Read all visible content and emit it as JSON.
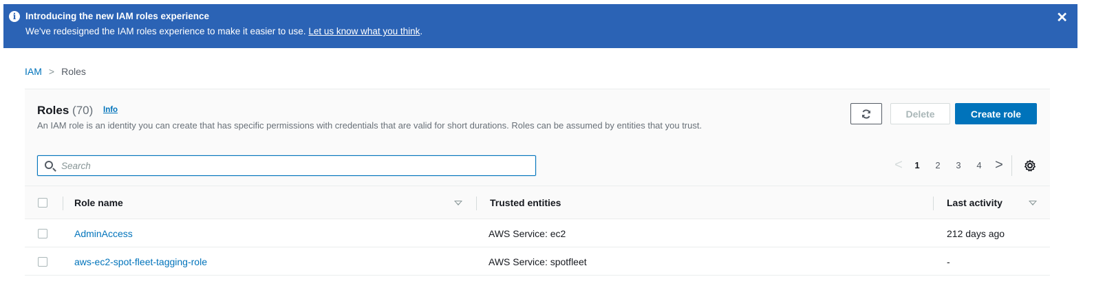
{
  "banner": {
    "title": "Introducing the new IAM roles experience",
    "message": "We've redesigned the IAM roles experience to make it easier to use.",
    "link_text": "Let us know what you think",
    "link_suffix": ".",
    "close_symbol": "✕"
  },
  "breadcrumb": {
    "root": "IAM",
    "separator": ">",
    "current": "Roles"
  },
  "header": {
    "title": "Roles",
    "count": "(70)",
    "info_label": "Info",
    "description": "An IAM role is an identity you can create that has specific permissions with credentials that are valid for short durations. Roles can be assumed by entities that you trust."
  },
  "actions": {
    "refresh_icon": "refresh-icon",
    "delete_label": "Delete",
    "create_label": "Create role"
  },
  "search": {
    "placeholder": "Search",
    "value": ""
  },
  "pagination": {
    "prev": "<",
    "pages": [
      "1",
      "2",
      "3",
      "4"
    ],
    "current_page": "1",
    "next": ">"
  },
  "table": {
    "columns": {
      "role_name": "Role name",
      "trusted_entities": "Trusted entities",
      "last_activity": "Last activity"
    },
    "rows": [
      {
        "role_name": "AdminAccess",
        "trusted_entities": "AWS Service: ec2",
        "last_activity": "212 days ago"
      },
      {
        "role_name": "aws-ec2-spot-fleet-tagging-role",
        "trusted_entities": "AWS Service: spotfleet",
        "last_activity": "-"
      }
    ]
  },
  "colors": {
    "banner_bg": "#2b63b5",
    "link": "#0073bb",
    "primary_button": "#0073bb"
  }
}
